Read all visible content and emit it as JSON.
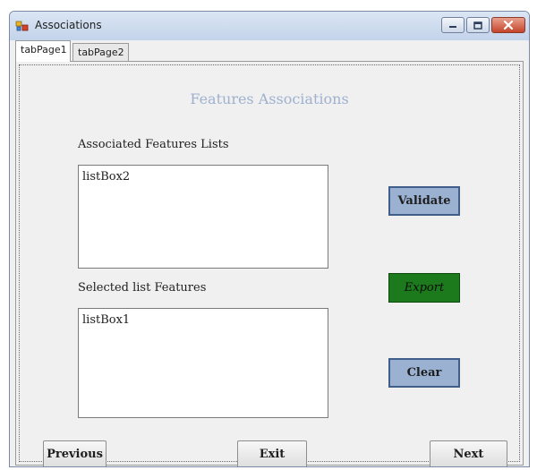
{
  "window": {
    "title": "Associations"
  },
  "tabs": [
    {
      "label": "tabPage1",
      "active": true
    },
    {
      "label": "tabPage2",
      "active": false
    }
  ],
  "main": {
    "heading": "Features Associations",
    "associated_label": "Associated Features Lists",
    "listbox_top": "listBox2",
    "selected_label": "Selected list Features",
    "listbox_bottom": "listBox1"
  },
  "buttons": {
    "validate": "Validate",
    "export": "Export",
    "clear": "Clear",
    "previous": "Previous",
    "exit": "Exit",
    "next": "Next"
  },
  "colors": {
    "validate_bg": "#9ab1d2",
    "export_bg": "#1c7a1c",
    "clear_bg": "#9ab1d2",
    "heading_text": "#9fb1cf"
  },
  "icons": {
    "app": "app-icon",
    "minimize": "minimize-icon",
    "maximize": "maximize-icon",
    "close": "close-icon"
  }
}
